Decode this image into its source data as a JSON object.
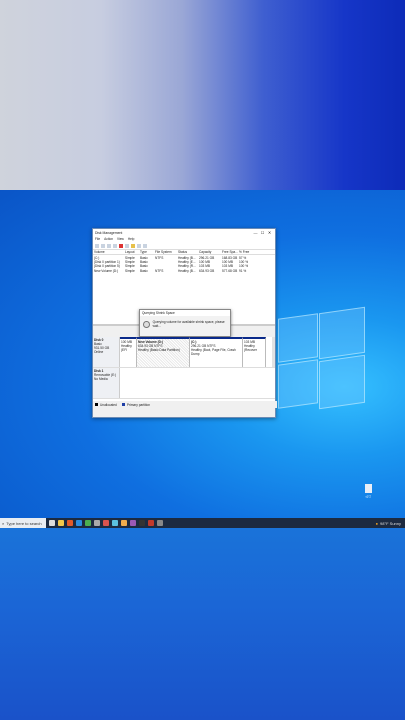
{
  "window": {
    "title": "Disk Management",
    "controls": [
      "—",
      "☐",
      "✕"
    ]
  },
  "menu": [
    "File",
    "Action",
    "View",
    "Help"
  ],
  "volume_table": {
    "headers": [
      "Volume",
      "Layout",
      "Type",
      "File System",
      "Status",
      "Capacity",
      "Free Spa...",
      "% Free"
    ],
    "rows": [
      [
        "(C:)",
        "Simple",
        "Basic",
        "NTFS",
        "Healthy (B...",
        "296.21 GB",
        "168.83 GB",
        "57 %"
      ],
      [
        "(Disk 0 partition 1)",
        "Simple",
        "Basic",
        "",
        "Healthy (E...",
        "100 MB",
        "100 MB",
        "100 %"
      ],
      [
        "(Disk 0 partition 5)",
        "Simple",
        "Basic",
        "",
        "Healthy (R...",
        "103 MB",
        "103 MB",
        "100 %"
      ],
      [
        "New Volume (D:)",
        "Simple",
        "Basic",
        "NTFS",
        "Healthy (B...",
        "634.93 GB",
        "577.68 GB",
        "91 %"
      ]
    ]
  },
  "dialog": {
    "title": "Querying Shrink Space",
    "message": "Querying volume for available shrink space, please wait..."
  },
  "disks": [
    {
      "name": "Disk 0",
      "type": "Basic",
      "size": "931.50 GB",
      "state": "Online",
      "partitions": [
        {
          "name": "",
          "size": "100 MB",
          "status": "Healthy (EFI"
        },
        {
          "name": "New Volume (D:)",
          "size": "634.93 GB NTFS",
          "status": "Healthy (Basic Data Partition)"
        },
        {
          "name": "(C:)",
          "size": "296.21 GB NTFS",
          "status": "Healthy (Boot, Page File, Crash Dump"
        },
        {
          "name": "",
          "size": "103 MB",
          "status": "Healthy (Recover"
        }
      ]
    },
    {
      "name": "Disk 1",
      "type": "Removable (E:)",
      "size": "",
      "state": "No Media",
      "partitions": []
    }
  ],
  "legend": {
    "unallocated": "Unallocated",
    "primary": "Primary partition",
    "colors": {
      "unallocated": "#000000",
      "primary": "#1f3fa6"
    }
  },
  "desktop_icon": {
    "label": "এ্যা"
  },
  "taskbar": {
    "search_placeholder": "Type here to search",
    "weather": "98°F Sunny"
  }
}
